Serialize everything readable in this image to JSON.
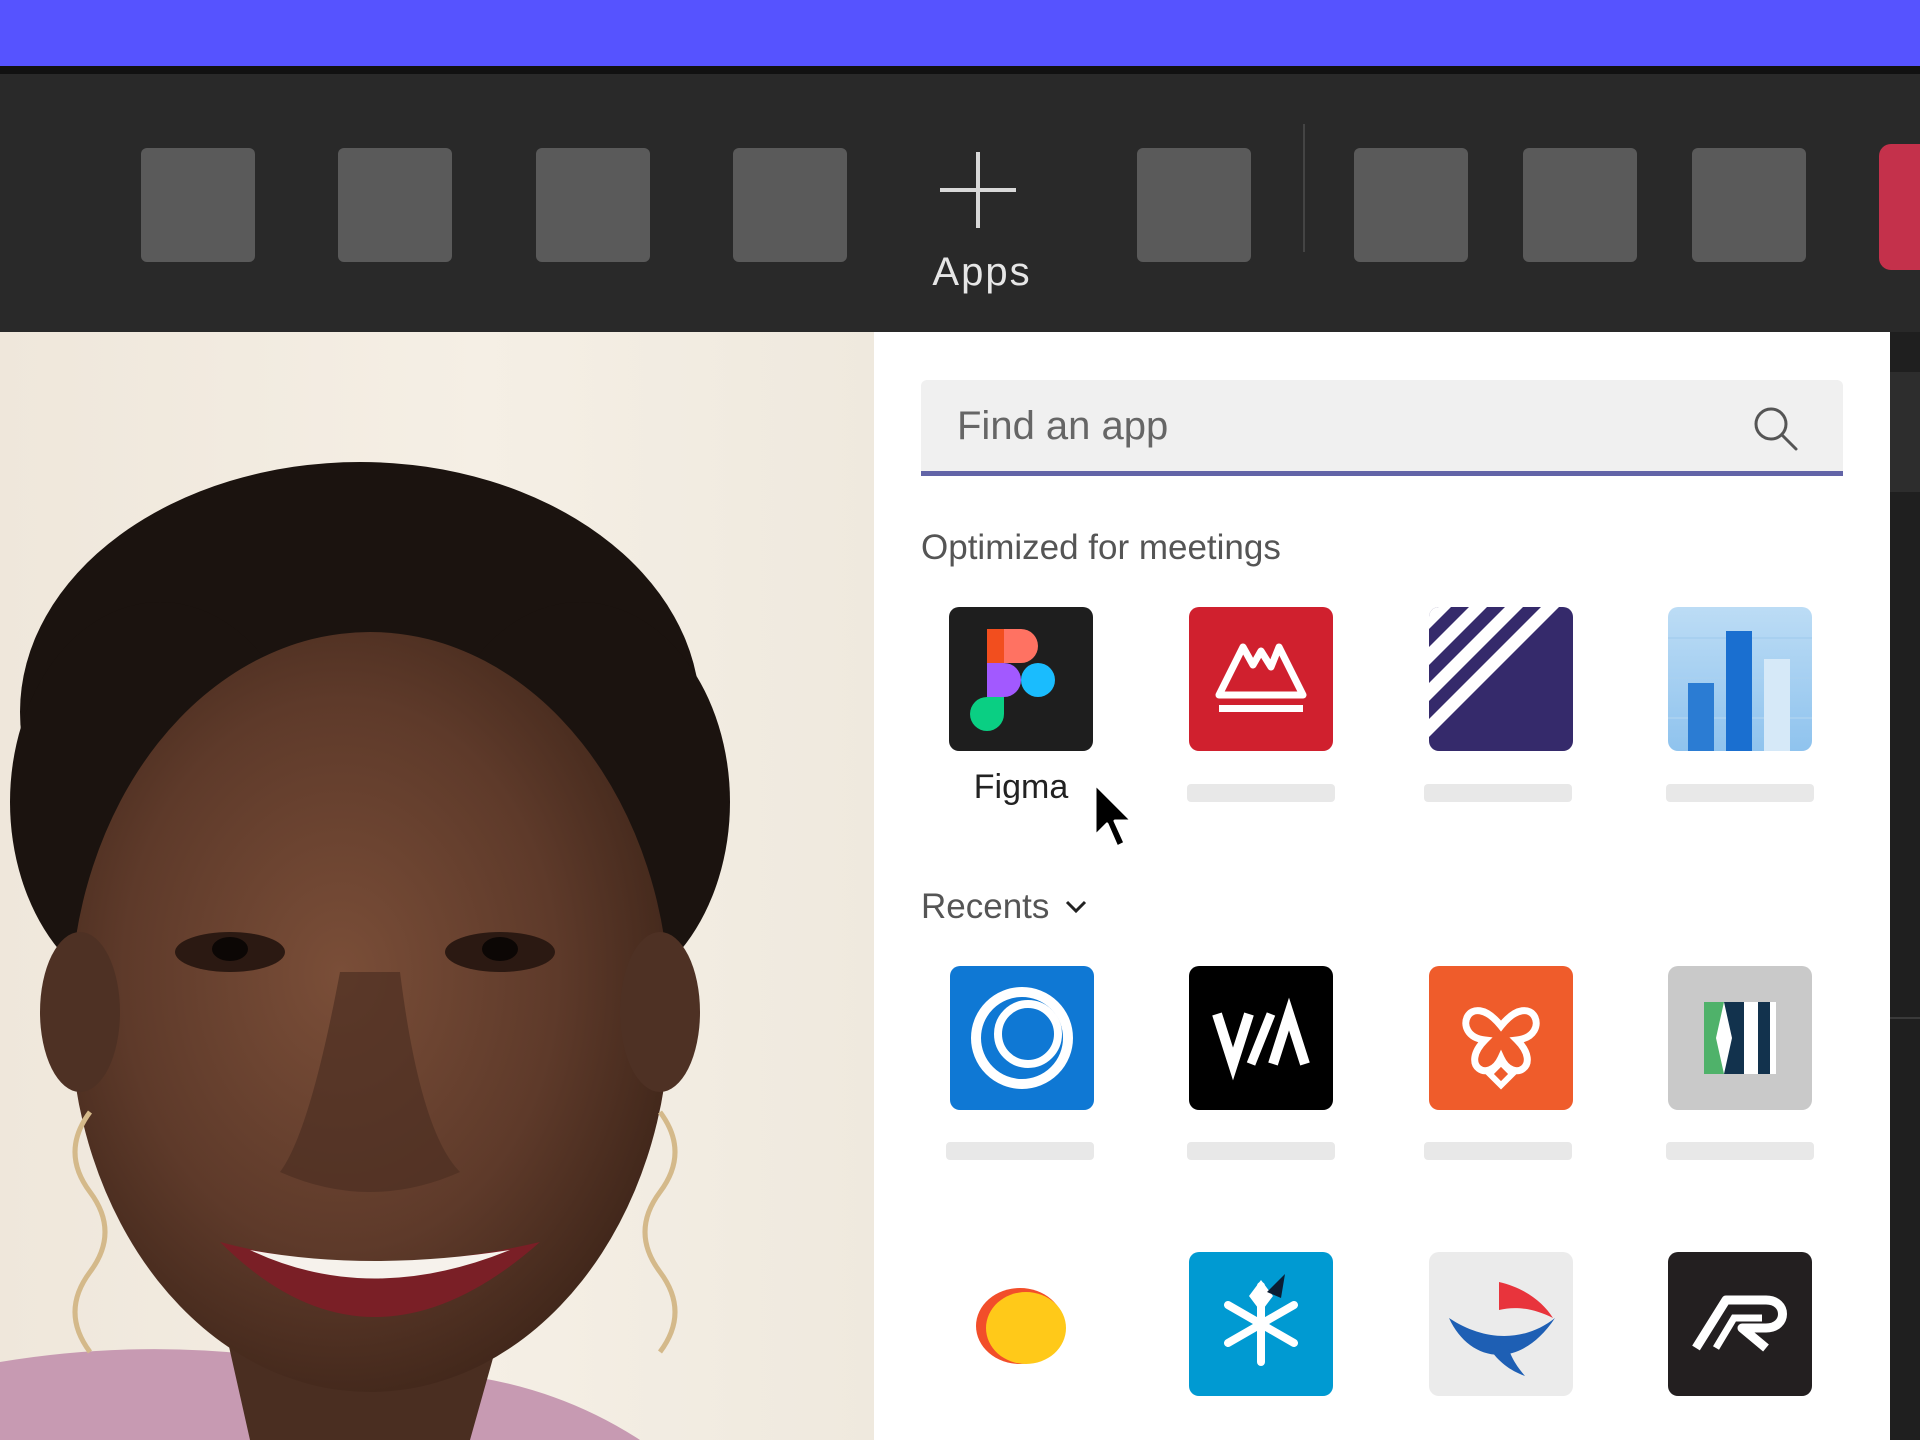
{
  "colors": {
    "brand": "#5653ff",
    "accent": "#6264a7",
    "end_button": "#c4314b",
    "toolbar": "#292929"
  },
  "toolbar": {
    "apps_label": "Apps",
    "apps_icon": "plus-icon"
  },
  "app_picker": {
    "search": {
      "placeholder": "Find an app",
      "value": "",
      "icon": "search-icon"
    },
    "sections": [
      {
        "title": "Optimized for meetings",
        "apps": [
          {
            "name": "Figma",
            "icon": "figma-logo-icon"
          },
          {
            "name": "",
            "icon": "mountain-logo-icon"
          },
          {
            "name": "",
            "icon": "diagonal-stripes-logo-icon"
          },
          {
            "name": "",
            "icon": "bar-chart-logo-icon"
          }
        ]
      },
      {
        "title": "Recents",
        "collapse_icon": "chevron-down-icon",
        "apps": [
          {
            "name": "",
            "icon": "ring-logo-icon"
          },
          {
            "name": "",
            "icon": "va-logo-icon"
          },
          {
            "name": "",
            "icon": "knot-logo-icon"
          },
          {
            "name": "",
            "icon": "bracket-logo-icon"
          },
          {
            "name": "",
            "icon": "blob-logo-icon"
          },
          {
            "name": "",
            "icon": "snowflake-logo-icon"
          },
          {
            "name": "",
            "icon": "bird-logo-icon"
          },
          {
            "name": "",
            "icon": "r-logo-icon"
          }
        ]
      }
    ]
  }
}
